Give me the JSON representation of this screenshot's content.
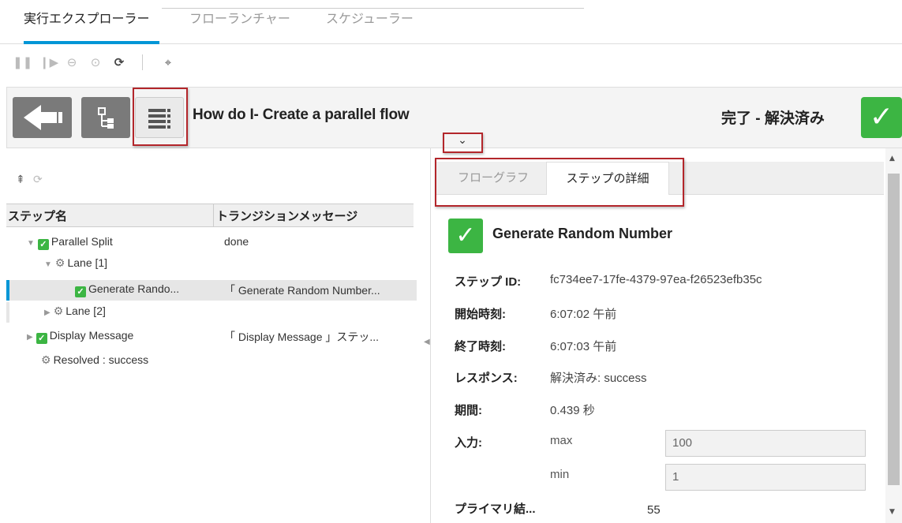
{
  "top_tabs": [
    {
      "label": "実行エクスプローラー",
      "active": true
    },
    {
      "label": "フローランチャー",
      "active": false
    },
    {
      "label": "スケジューラー",
      "active": false
    }
  ],
  "toolbar": {
    "icons": [
      "pause-icon",
      "step-forward-icon",
      "cancel-icon",
      "resume-icon",
      "refresh-icon",
      "cursor-icon"
    ]
  },
  "header": {
    "flow_title": "How do I- Create a parallel flow",
    "status": "完了 - 解決済み",
    "status_color": "#3cb543"
  },
  "tree": {
    "columns": [
      "ステップ名",
      "トランジションメッセージ"
    ],
    "rows": [
      {
        "name": "Parallel Split",
        "message": "done"
      },
      {
        "name": "Lane [1]",
        "message": ""
      },
      {
        "name": "Generate Rando...",
        "message": "「 Generate Random Number..."
      },
      {
        "name": "Lane [2]",
        "message": ""
      },
      {
        "name": "Display Message",
        "message": "「 Display Message 」ステッ..."
      },
      {
        "name": "Resolved : success",
        "message": ""
      }
    ]
  },
  "detail_tabs": [
    "フローグラフ",
    "ステップの詳細"
  ],
  "step": {
    "title": "Generate Random Number",
    "fields": [
      {
        "label": "ステップ ID:",
        "value": "fc734ee7-17fe-4379-97ea-f26523efb35c"
      },
      {
        "label": "開始時刻:",
        "value": "6:07:02 午前"
      },
      {
        "label": "終了時刻:",
        "value": "6:07:03 午前"
      },
      {
        "label": "レスポンス:",
        "value": "解決済み: success"
      },
      {
        "label": "期間:",
        "value": "0.439 秒"
      }
    ],
    "inputs_label": "入力:",
    "inputs": [
      {
        "name": "max",
        "value": "100"
      },
      {
        "name": "min",
        "value": "1"
      }
    ],
    "primary_label": "プライマリ結...",
    "primary_value": "55"
  },
  "accent_color": "#0096d6",
  "highlight_color": "#b3262b"
}
